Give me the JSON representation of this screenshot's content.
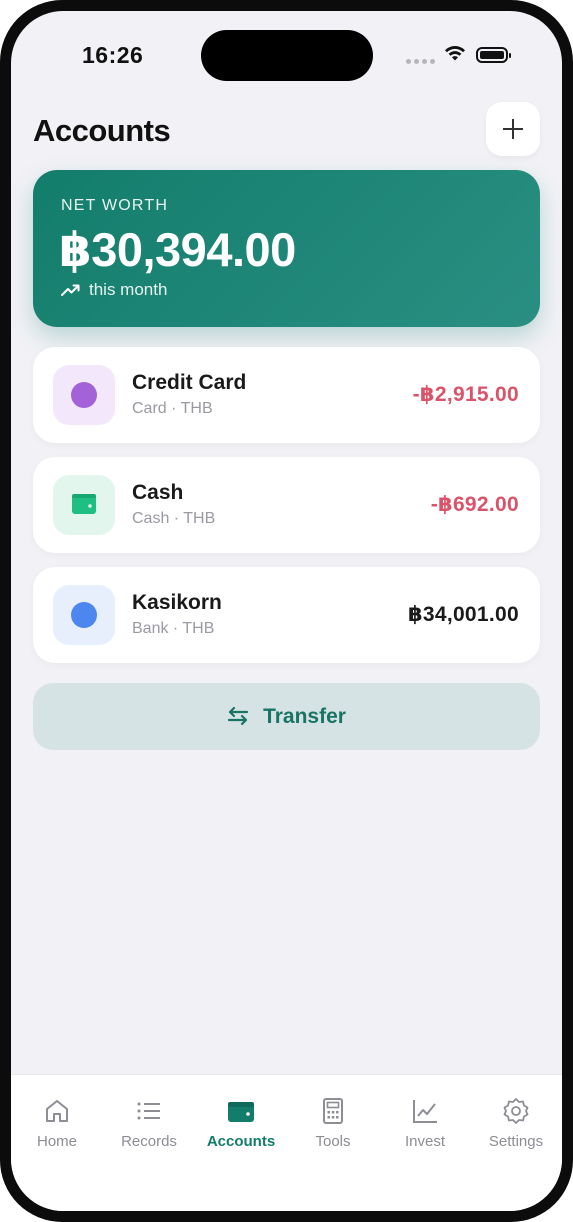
{
  "status_bar": {
    "time": "16:26"
  },
  "header": {
    "title": "Accounts",
    "add_icon": "plus-icon"
  },
  "net_worth": {
    "label": "NET WORTH",
    "value": "฿30,394.00",
    "trend_text": "this month",
    "trend_icon": "trend-up-icon"
  },
  "accounts": [
    {
      "name": "Credit Card",
      "type": "Card · THB",
      "amount": "-฿2,915.00",
      "icon_color": "#a362d8",
      "icon_bg": "#f3e8fb"
    },
    {
      "name": "Cash",
      "type": "Cash · THB",
      "amount": "-฿692.00",
      "icon_color": "#1fbf84",
      "icon_bg": "#e3f6ee"
    },
    {
      "name": "Kasikorn",
      "type": "Bank · THB",
      "amount": "฿34,001.00",
      "icon_color": "#4d86ef",
      "icon_bg": "#e7effd"
    }
  ],
  "transfer": {
    "label": "Transfer",
    "icon": "swap-arrows-icon"
  },
  "tabs": [
    {
      "label": "Home",
      "icon": "home-icon"
    },
    {
      "label": "Records",
      "icon": "list-icon"
    },
    {
      "label": "Accounts",
      "icon": "wallet-icon",
      "active": true
    },
    {
      "label": "Tools",
      "icon": "calculator-icon"
    },
    {
      "label": "Invest",
      "icon": "chart-icon"
    },
    {
      "label": "Settings",
      "icon": "gear-icon"
    }
  ],
  "colors": {
    "accent": "#137d6b",
    "negative": "#d9546a"
  }
}
